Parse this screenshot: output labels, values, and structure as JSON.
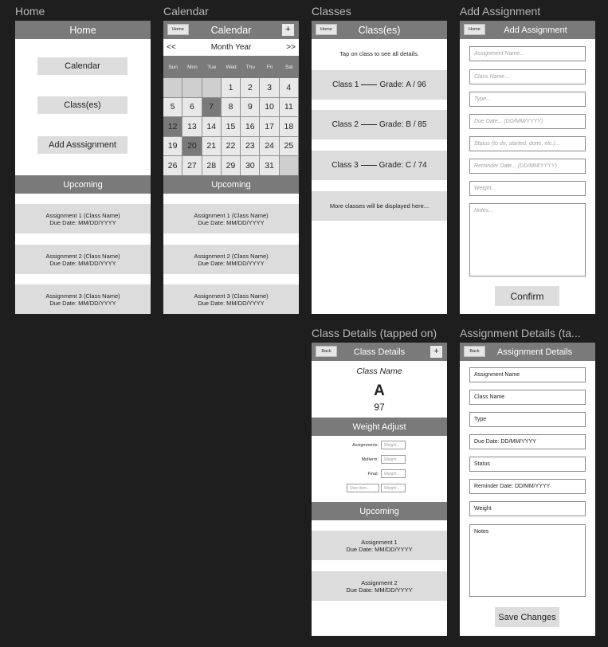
{
  "frame_titles": {
    "home": "Home",
    "calendar": "Calendar",
    "classes": "Classes",
    "add_assignment": "Add Assignment",
    "class_details": "Class Details (tapped on)",
    "assignment_details": "Assignment Details (ta..."
  },
  "home": {
    "header": "Home",
    "buttons": [
      "Calendar",
      "Class(es)",
      "Add Asssignment"
    ],
    "upcoming_label": "Upcoming",
    "assignments": [
      {
        "title": "Assignment 1 (Class Name)",
        "due": "Due Date: MM/DD/YYYY"
      },
      {
        "title": "Assignment 2 (Class Name)",
        "due": "Due Date: MM/DD/YYYY"
      },
      {
        "title": "Assignment 3 (Class Name)",
        "due": "Due Date: MM/DD/YYYY"
      }
    ]
  },
  "calendar": {
    "home_button": "Home",
    "header": "Calendar",
    "add_button": "+",
    "prev": "<<",
    "month_year": "Month Year",
    "next": ">>",
    "weekdays": [
      "Sun",
      "Mon",
      "Tue",
      "Wed",
      "Thu",
      "Fri",
      "Sat"
    ],
    "days": [
      "",
      "",
      "",
      "1",
      "2",
      "3",
      "4",
      "5",
      "6",
      "7",
      "8",
      "9",
      "10",
      "11",
      "12",
      "13",
      "14",
      "15",
      "16",
      "17",
      "18",
      "19",
      "20",
      "21",
      "22",
      "23",
      "24",
      "25",
      "26",
      "27",
      "28",
      "29",
      "30",
      "31",
      ""
    ],
    "highlighted_days": [
      "7",
      "12",
      "20"
    ],
    "upcoming_label": "Upcoming",
    "assignments": [
      {
        "title": "Assignment 1 (Class Name)",
        "due": "Due Date: MM/DD/YYYY"
      },
      {
        "title": "Assignment 2 (Class Name)",
        "due": "Due Date: MM/DD/YYYY"
      },
      {
        "title": "Assignment 3 (Class Name)",
        "due": "Due Date: MM/DD/YYYY"
      }
    ]
  },
  "classes": {
    "home_button": "Home",
    "header": "Class(es)",
    "hint": "Tap on class to see all details.",
    "items": [
      {
        "name": "Class 1",
        "grade": "Grade: A / 96"
      },
      {
        "name": "Class 2",
        "grade": "Grade: B / 85"
      },
      {
        "name": "Class 3",
        "grade": "Grade: C / 74"
      }
    ],
    "more": "More classes will be displayed here..."
  },
  "add_assignment": {
    "home_button": "Home",
    "header": "Add Assignment",
    "placeholders": [
      "Assignment Name...",
      "Class Name...",
      "Type...",
      "Due Date... (DD/MM/YYYY)",
      "Status (to do, started, done, etc.)...",
      "Reminder Date... (DD/MM/YYYY)",
      "Weight...",
      "Notes..."
    ],
    "confirm": "Confirm"
  },
  "class_details": {
    "back_button": "Back",
    "header": "Class Details",
    "add_button": "+",
    "class_name": "Class Name",
    "grade_letter": "A",
    "grade_number": "97",
    "weight_label": "Weight Adjust",
    "weights": [
      {
        "label": "Assignments:",
        "placeholder": "Weight..."
      },
      {
        "label": "Midterm:",
        "placeholder": "Weight..."
      },
      {
        "label": "Final:",
        "placeholder": "Weight..."
      }
    ],
    "new_item_placeholder": "New item...",
    "new_weight_placeholder": "Weight...",
    "upcoming_label": "Upcoming",
    "assignments": [
      {
        "title": "Assignment 1",
        "due": "Due Date: MM/DD/YYYY"
      },
      {
        "title": "Assignment 2",
        "due": "Due Date: MM/DD/YYYY"
      }
    ]
  },
  "assignment_details": {
    "back_button": "Back",
    "header": "Assignment Details",
    "fields": [
      "Assignment Name",
      "Class Name",
      "Type",
      "Due Date: DD/MM/YYYY",
      "Status",
      "Reminder Date: DD/MM/YYYY",
      "Weight",
      "Notes"
    ],
    "save": "Save Changes"
  }
}
